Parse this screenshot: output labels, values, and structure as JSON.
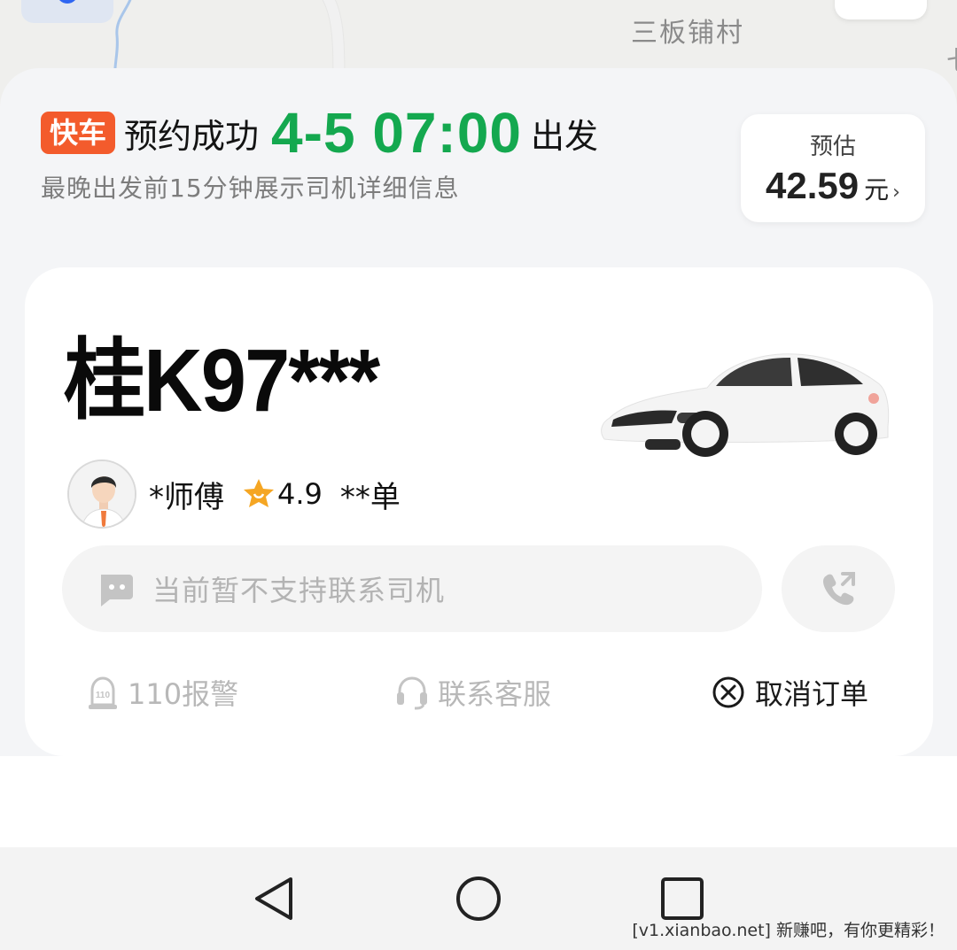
{
  "map": {
    "place_label": "三板铺村",
    "edge_glyph": "七"
  },
  "header": {
    "badge": "快车",
    "status": "预约成功",
    "departure_time": "4-5 07:00",
    "departure_suffix": "出发",
    "subtitle": "最晚出发前15分钟展示司机详细信息"
  },
  "estimate": {
    "label": "预估",
    "amount": "42.59",
    "unit": "元",
    "chevron": "›"
  },
  "driver": {
    "plate": "桂K97***",
    "name": "*师傅",
    "rating": "4.9",
    "orders": "**单"
  },
  "message": {
    "placeholder": "当前暂不支持联系司机"
  },
  "actions": {
    "police": "110报警",
    "service": "联系客服",
    "cancel": "取消订单"
  },
  "colors": {
    "badge": "#f35b2c",
    "time_green": "#14a84f",
    "star": "#f5a623"
  },
  "watermark": "[v1.xianbao.net] 新赚吧，有你更精彩！"
}
